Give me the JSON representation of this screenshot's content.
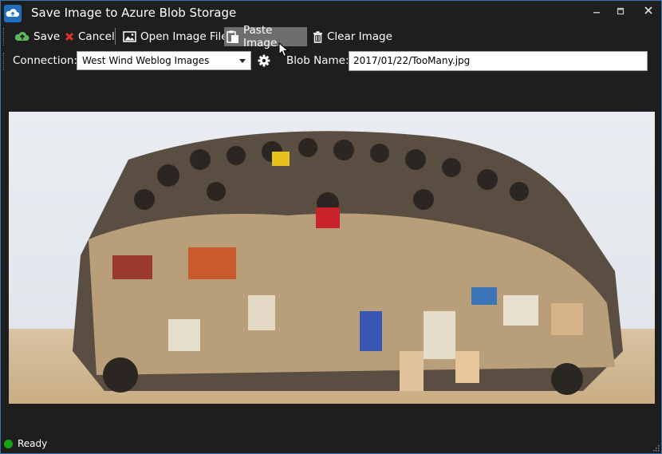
{
  "window": {
    "title": "Save Image to Azure Blob Storage",
    "app_icon": "cloud-upload-icon",
    "controls": [
      "minimize-icon",
      "maximize-icon",
      "close-icon"
    ]
  },
  "toolbar": {
    "save_label": "Save",
    "cancel_label": "Cancel",
    "open_label": "Open Image File",
    "paste_label": "Paste Image",
    "clear_label": "Clear Image",
    "colors": {
      "save_icon": "#5cb85c",
      "cancel_icon": "#e0302f",
      "hover_bg": "#6e6e6e"
    }
  },
  "form": {
    "connection_label": "Connection:",
    "connection_value": "West Wind Weblog Images",
    "blob_label": "Blob Name:",
    "blob_value": "2017/01/22/TooMany.jpg",
    "settings_icon": "gear-icon"
  },
  "image": {
    "description": "Overloaded truck with people and jerry cans"
  },
  "status": {
    "text": "Ready",
    "color": "#16a316"
  }
}
